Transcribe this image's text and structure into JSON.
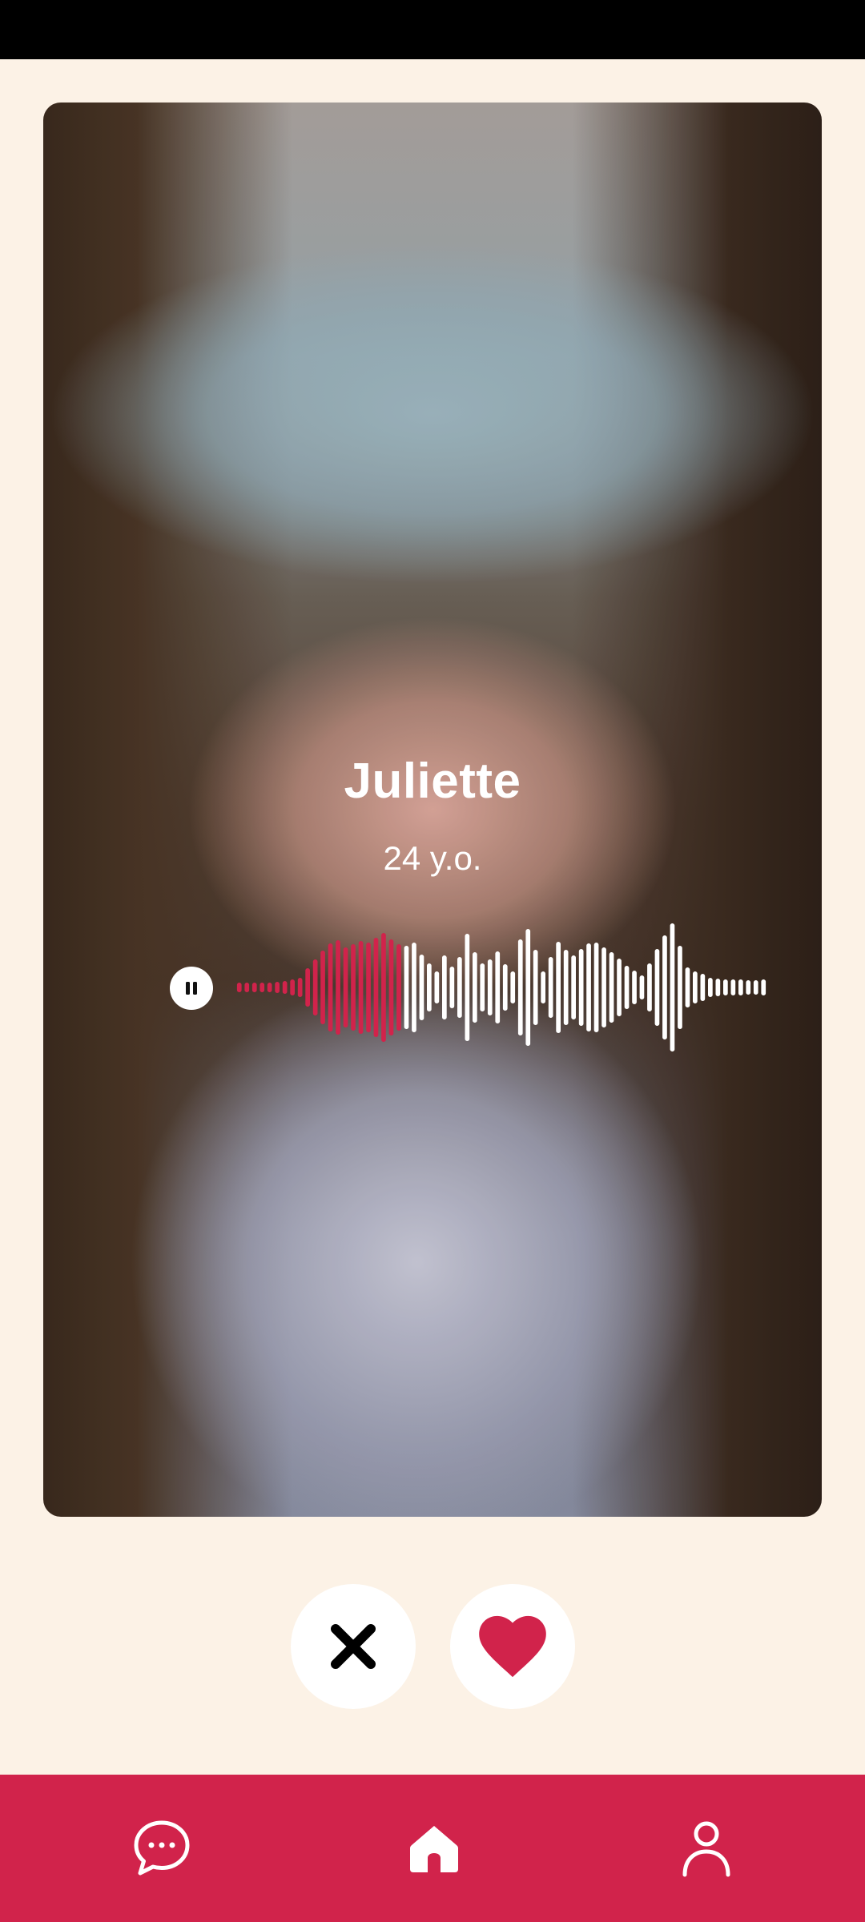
{
  "profile": {
    "name": "Juliette",
    "age": "24 y.o."
  },
  "audio": {
    "state": "playing",
    "control_icon": "pause-icon",
    "progress": 0.31,
    "played_color": "#D1234B",
    "unplayed_color": "#FFFFFF"
  },
  "actions": {
    "dislike_icon": "close-icon",
    "like_icon": "heart-icon",
    "like_color": "#D1234B"
  },
  "bottom_nav": {
    "items": [
      {
        "id": "messages",
        "icon": "chat-icon"
      },
      {
        "id": "home",
        "icon": "home-icon",
        "active": true
      },
      {
        "id": "profile",
        "icon": "person-icon"
      }
    ]
  },
  "colors": {
    "background": "#FCF2E6",
    "accent": "#D1234B",
    "status_bar": "#000000"
  }
}
